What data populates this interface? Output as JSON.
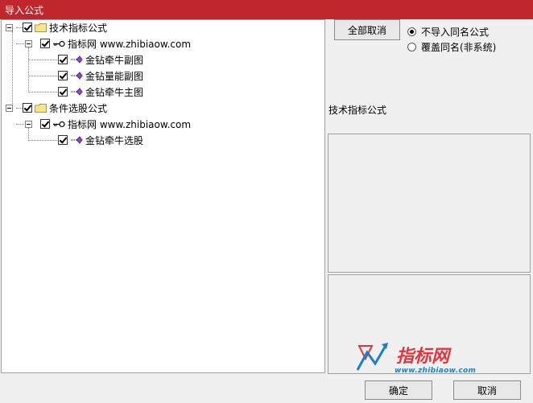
{
  "window": {
    "title": "导入公式"
  },
  "colors": {
    "titlebar": "#c0272d",
    "logo_red": "#e0373f",
    "logo_blue": "#1e7fc8"
  },
  "tree": {
    "nodes": [
      {
        "label": "技术指标公式",
        "icon": "folder-icon",
        "checked": true,
        "expanded": true
      },
      {
        "label": "指标网 www.zhibiaow.com",
        "icon": "key-icon",
        "checked": true,
        "expanded": true
      },
      {
        "label": "金钻牵牛副图",
        "icon": "formula-icon",
        "checked": true
      },
      {
        "label": "金钻量能副图",
        "icon": "formula-icon",
        "checked": true
      },
      {
        "label": "金钻牵牛主图",
        "icon": "formula-icon",
        "checked": true
      },
      {
        "label": "条件选股公式",
        "icon": "folder-icon",
        "checked": true,
        "expanded": true
      },
      {
        "label": "指标网 www.zhibiaow.com",
        "icon": "key-icon",
        "checked": true,
        "expanded": true
      },
      {
        "label": "金钻牵牛选股",
        "icon": "formula-icon",
        "checked": true
      }
    ]
  },
  "side": {
    "cancel_all_label": "全部取消",
    "radio_options": [
      {
        "label": "不导入同名公式",
        "selected": true
      },
      {
        "label": "覆盖同名(非系统)",
        "selected": false
      }
    ],
    "section_label": "技术指标公式"
  },
  "logo": {
    "brand_text": "指标网",
    "url_text": "www.zhibiaow.com"
  },
  "footer": {
    "ok_label": "确定",
    "cancel_label": "取消"
  }
}
